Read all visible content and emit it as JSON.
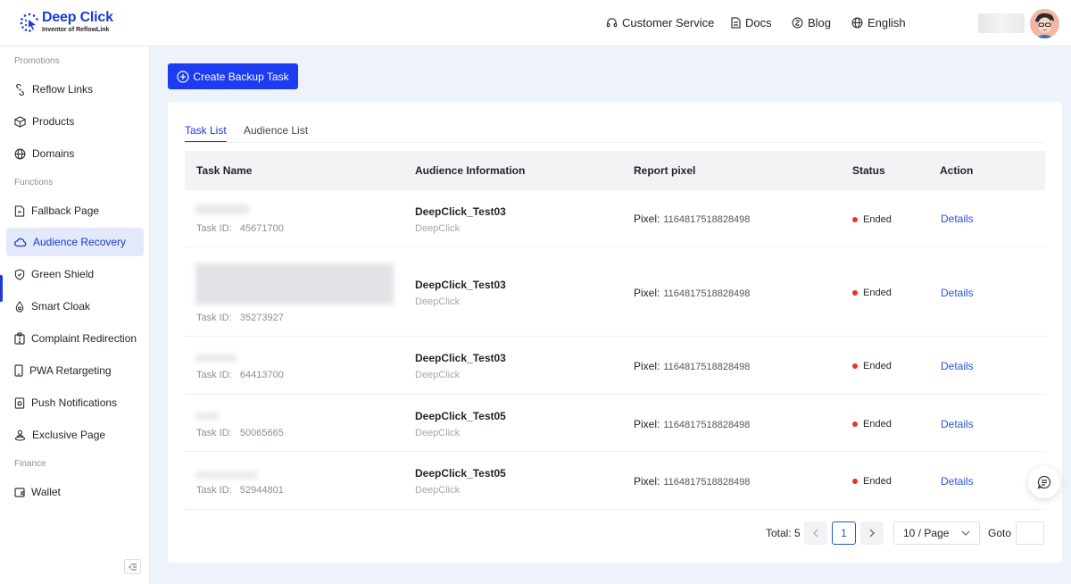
{
  "brand": {
    "title": "Deep Click",
    "subtitle": "Inventor of ReflowLink",
    "accent": "#1d3bf0"
  },
  "header": {
    "nav": [
      {
        "label": "Customer Service",
        "icon": "headset-icon"
      },
      {
        "label": "Docs",
        "icon": "document-icon"
      },
      {
        "label": "Blog",
        "icon": "blog-icon"
      },
      {
        "label": "English",
        "icon": "globe-icon"
      }
    ]
  },
  "sidebar": {
    "sections": [
      {
        "title": "Promotions"
      },
      {
        "title": "Functions"
      },
      {
        "title": "Finance"
      }
    ],
    "items": [
      {
        "label": "Reflow Links",
        "icon": "link-icon"
      },
      {
        "label": "Products",
        "icon": "box-icon"
      },
      {
        "label": "Domains",
        "icon": "globe-icon"
      },
      {
        "label": "Fallback Page",
        "icon": "page-icon"
      },
      {
        "label": "Audience Recovery",
        "icon": "cloud-icon",
        "active": true
      },
      {
        "label": "Green Shield",
        "icon": "shield-icon"
      },
      {
        "label": "Smart Cloak",
        "icon": "cloak-icon"
      },
      {
        "label": "Complaint Redirection",
        "icon": "complaint-icon"
      },
      {
        "label": "PWA Retargeting",
        "icon": "phone-icon"
      },
      {
        "label": "Push Notifications",
        "icon": "bell-icon"
      },
      {
        "label": "Exclusive Page",
        "icon": "exclusive-icon"
      },
      {
        "label": "Wallet",
        "icon": "wallet-icon"
      }
    ]
  },
  "main": {
    "create_button": "Create Backup Task",
    "tabs": [
      {
        "label": "Task List",
        "active": true
      },
      {
        "label": "Audience List",
        "active": false
      }
    ],
    "table": {
      "headers": [
        "Task Name",
        "Audience Information",
        "Report pixel",
        "Status",
        "Action"
      ],
      "rows": [
        {
          "task_id_label": "Task ID:",
          "task_id": "45671700",
          "audience": "DeepClick_Test03",
          "audience_sub": "DeepClick",
          "pixel_label": "Pixel:",
          "pixel": "1164817518828498",
          "status": "Ended",
          "action": "Details"
        },
        {
          "task_id_label": "Task ID:",
          "task_id": "35273927",
          "audience": "DeepClick_Test03",
          "audience_sub": "DeepClick",
          "pixel_label": "Pixel:",
          "pixel": "1164817518828498",
          "status": "Ended",
          "action": "Details"
        },
        {
          "task_id_label": "Task ID:",
          "task_id": "64413700",
          "audience": "DeepClick_Test03",
          "audience_sub": "DeepClick",
          "pixel_label": "Pixel:",
          "pixel": "1164817518828498",
          "status": "Ended",
          "action": "Details"
        },
        {
          "task_id_label": "Task ID:",
          "task_id": "50065665",
          "audience": "DeepClick_Test05",
          "audience_sub": "DeepClick",
          "pixel_label": "Pixel:",
          "pixel": "1164817518828498",
          "status": "Ended",
          "action": "Details"
        },
        {
          "task_id_label": "Task ID:",
          "task_id": "52944801",
          "audience": "DeepClick_Test05",
          "audience_sub": "DeepClick",
          "pixel_label": "Pixel:",
          "pixel": "1164817518828498",
          "status": "Ended",
          "action": "Details"
        }
      ]
    },
    "pagination": {
      "total": "Total: 5",
      "current_page": "1",
      "page_size": "10 / Page",
      "goto_label": "Goto",
      "goto_value": ""
    }
  },
  "colors": {
    "status_ended": "#e8322a",
    "link": "#2455d6",
    "active_bg": "#e3e8fb"
  }
}
